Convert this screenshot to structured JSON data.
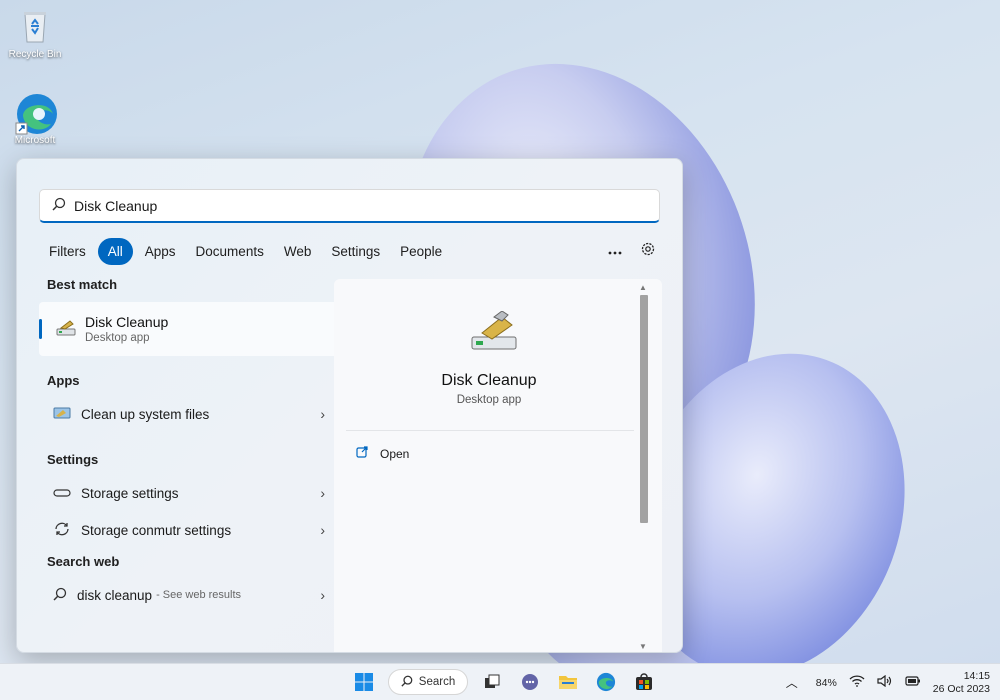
{
  "desktop": {
    "icons": [
      {
        "label": "Recycle Bin",
        "icon": "recycle-bin-icon"
      },
      {
        "label": "Microsoft",
        "icon": "edge-icon"
      }
    ]
  },
  "search": {
    "query": "Disk Cleanup",
    "filters": [
      "Filters",
      "All",
      "Apps",
      "Documents",
      "Web",
      "Settings",
      "People"
    ],
    "active_filter": "All",
    "more_icon": "ellipsis-icon",
    "settings_icon": "gear-icon"
  },
  "results": {
    "best_match_title": "Best match",
    "best_match": {
      "name": "Disk Cleanup",
      "type": "Desktop app"
    },
    "apps_title": "Apps",
    "apps": [
      {
        "label": "Clean up system files"
      }
    ],
    "settings_title": "Settings",
    "settings": [
      {
        "label": "Storage settings"
      },
      {
        "label": "Storage conmutr settings"
      }
    ],
    "web_title": "Search web",
    "web": {
      "query": "disk cleanup",
      "hint": "- See web results"
    }
  },
  "preview": {
    "name": "Disk Cleanup",
    "type": "Desktop app",
    "actions": [
      {
        "label": "Open",
        "icon": "open-external-icon"
      }
    ]
  },
  "taskbar": {
    "search_label": "Search",
    "battery": "84%",
    "time": "14:15",
    "date": "26 Oct 2023"
  },
  "colors": {
    "accent": "#0067c0"
  }
}
